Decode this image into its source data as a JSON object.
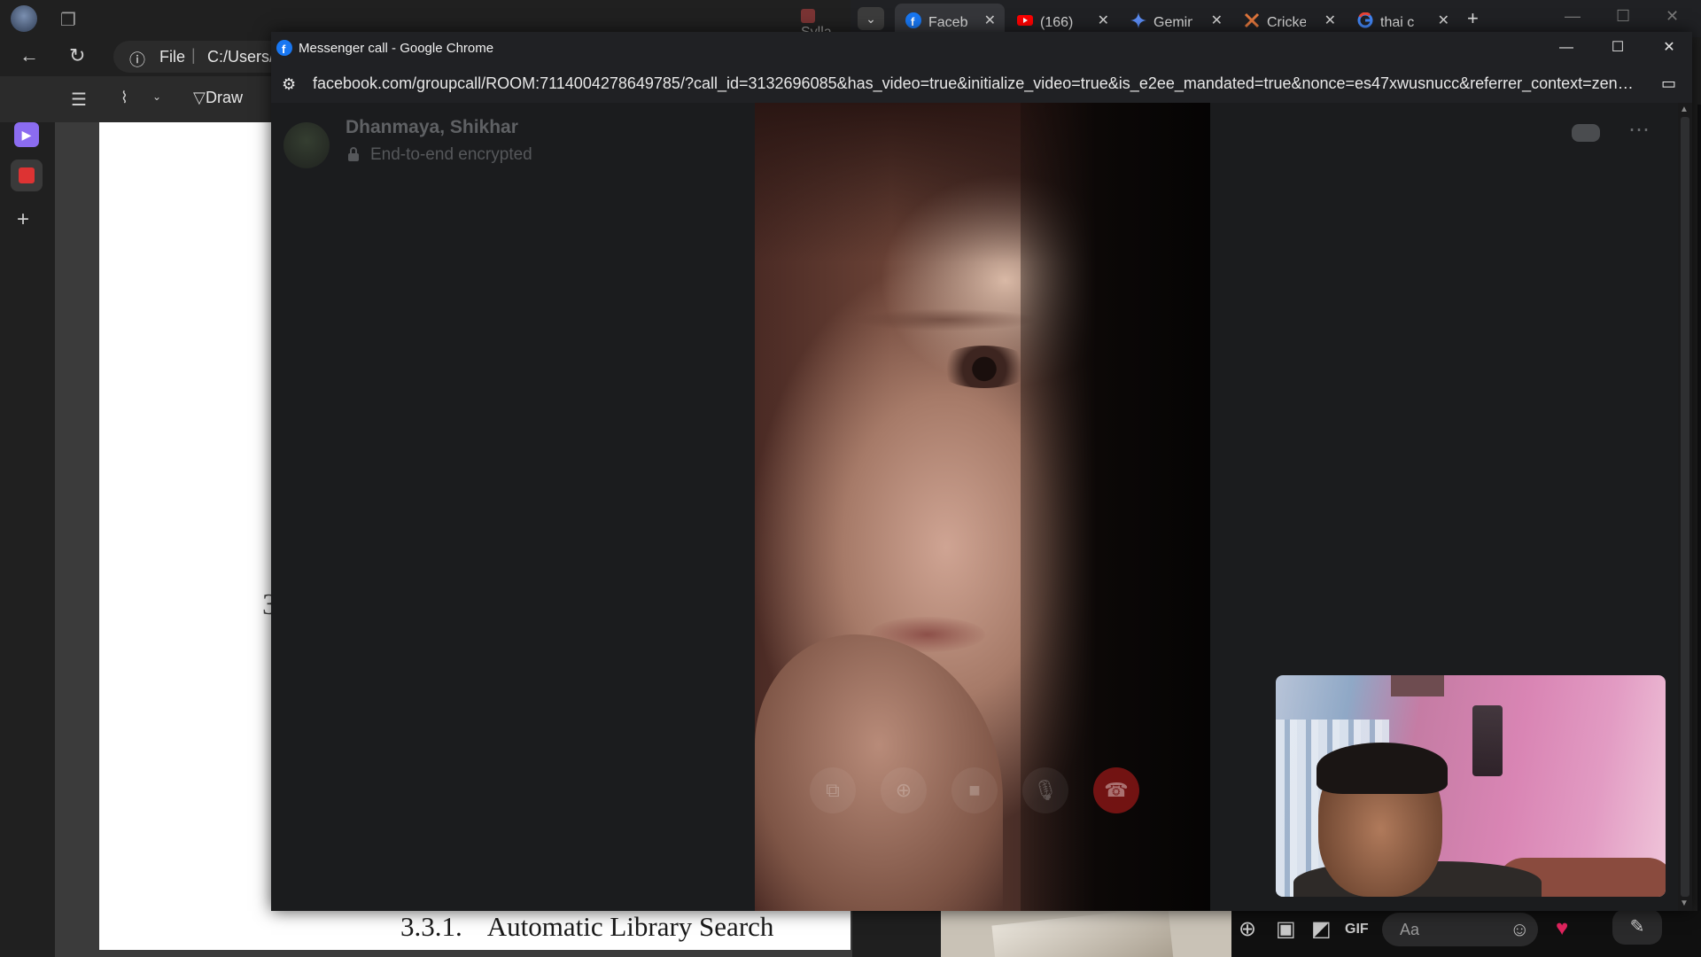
{
  "background_app": {
    "url_label": "File",
    "url_path": "C:/Users/",
    "toolbar_draw": "Draw",
    "pdf_heading_number": "3.3.1.",
    "pdf_heading_text": "Automatic Library Search",
    "pdf_margin_mark": "3",
    "tab_fragment": "Sylla"
  },
  "browser_tabs": [
    {
      "label": "Faceb",
      "icon": "facebook-icon",
      "active": true
    },
    {
      "label": "(166)",
      "icon": "youtube-icon",
      "active": false
    },
    {
      "label": "Gemin",
      "icon": "gemini-icon",
      "active": false
    },
    {
      "label": "Cricke",
      "icon": "cricket-icon",
      "active": false
    },
    {
      "label": "thai c",
      "icon": "google-icon",
      "active": false
    }
  ],
  "popup": {
    "title": "Messenger call - Google Chrome",
    "url": "facebook.com/groupcall/ROOM:7114004278649785/?call_id=3132696085&has_video=true&initialize_video=true&is_e2ee_mandated=true&nonce=es47xwusnucc&referrer_context=zenon_pre..."
  },
  "call": {
    "participants": "Dhanmaya, Shikhar",
    "encryption": "End-to-end encrypted",
    "controls": [
      "screen-share",
      "add-person",
      "video",
      "microphone",
      "end-call"
    ]
  },
  "chat_bar": {
    "input_placeholder": "Aa",
    "gif_label": "GIF"
  },
  "colors": {
    "end_call": "#c81e1e",
    "facebook_blue": "#1877f2",
    "youtube_red": "#ff0000"
  }
}
